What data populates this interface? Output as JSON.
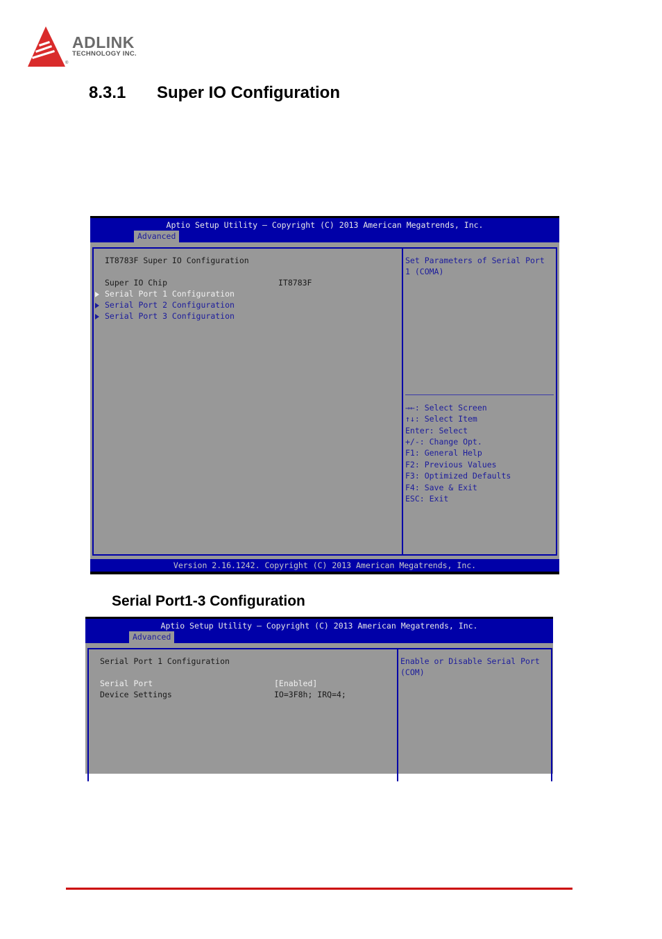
{
  "logo": {
    "brand": "ADLINK",
    "tagline": "TECHNOLOGY INC.",
    "registered_mark": "®",
    "brand_color": "#d92b2b"
  },
  "section": {
    "number": "8.3.1",
    "title": "Super IO Configuration"
  },
  "subsection": {
    "title": "Serial Port1-3 Configuration"
  },
  "screen1": {
    "header": "Aptio Setup Utility – Copyright (C) 2013 American Megatrends, Inc.",
    "active_tab": "Advanced",
    "page_title": "IT8783F Super IO Configuration",
    "rows": [
      {
        "label": "Super IO Chip",
        "value": "IT8783F"
      }
    ],
    "submenus": [
      {
        "label": "Serial Port 1 Configuration",
        "selected": true
      },
      {
        "label": "Serial Port 2 Configuration",
        "selected": false
      },
      {
        "label": "Serial Port 3 Configuration",
        "selected": false
      }
    ],
    "help": [
      "Set Parameters of Serial Port",
      "1 (COMA)"
    ],
    "keys": [
      "→←: Select Screen",
      "↑↓: Select Item",
      "Enter: Select",
      "+/-: Change Opt.",
      "F1: General Help",
      "F2: Previous Values",
      "F3: Optimized Defaults",
      "F4: Save & Exit",
      "ESC: Exit"
    ],
    "footer": "Version 2.16.1242. Copyright (C) 2013 American Megatrends, Inc."
  },
  "screen2": {
    "header": "Aptio Setup Utility – Copyright (C) 2013 American Megatrends, Inc.",
    "active_tab": "Advanced",
    "page_title": "Serial Port 1 Configuration",
    "rows": [
      {
        "label": "Serial Port",
        "value": "[Enabled]",
        "selected": true
      },
      {
        "label": "Device Settings",
        "value": "IO=3F8h; IRQ=4;",
        "selected": false
      }
    ],
    "help": [
      "Enable or Disable Serial Port",
      "(COM)"
    ]
  },
  "colors": {
    "bios_blue": "#0000a8",
    "bios_gray": "#989898",
    "footer_rule": "#cc0000"
  }
}
